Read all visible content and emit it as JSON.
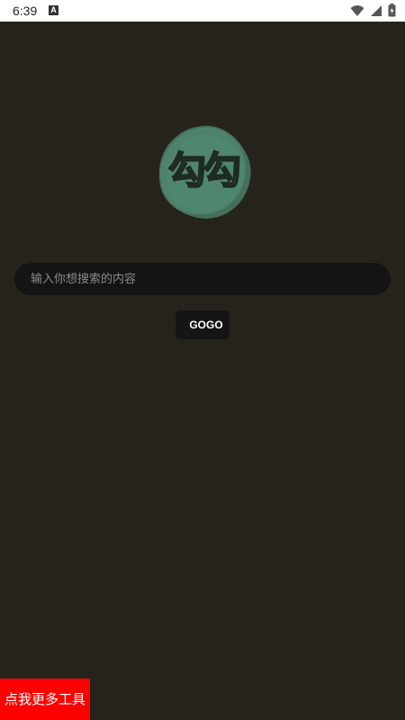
{
  "status_bar": {
    "time": "6:39",
    "notification_icon": "a-icon",
    "icons": [
      "wifi-icon",
      "cell-signal-icon",
      "battery-icon"
    ]
  },
  "logo": {
    "text": "勾勾",
    "icon": "logo-blob-icon",
    "color": "#4a7d67"
  },
  "search": {
    "placeholder": "输入你想搜索的内容",
    "value": ""
  },
  "buttons": {
    "gogo_label": "GOGO",
    "more_tools_label": "点我更多工具"
  },
  "colors": {
    "background": "#26231c",
    "input_bg": "#141414",
    "accent_red": "#ff0000"
  }
}
